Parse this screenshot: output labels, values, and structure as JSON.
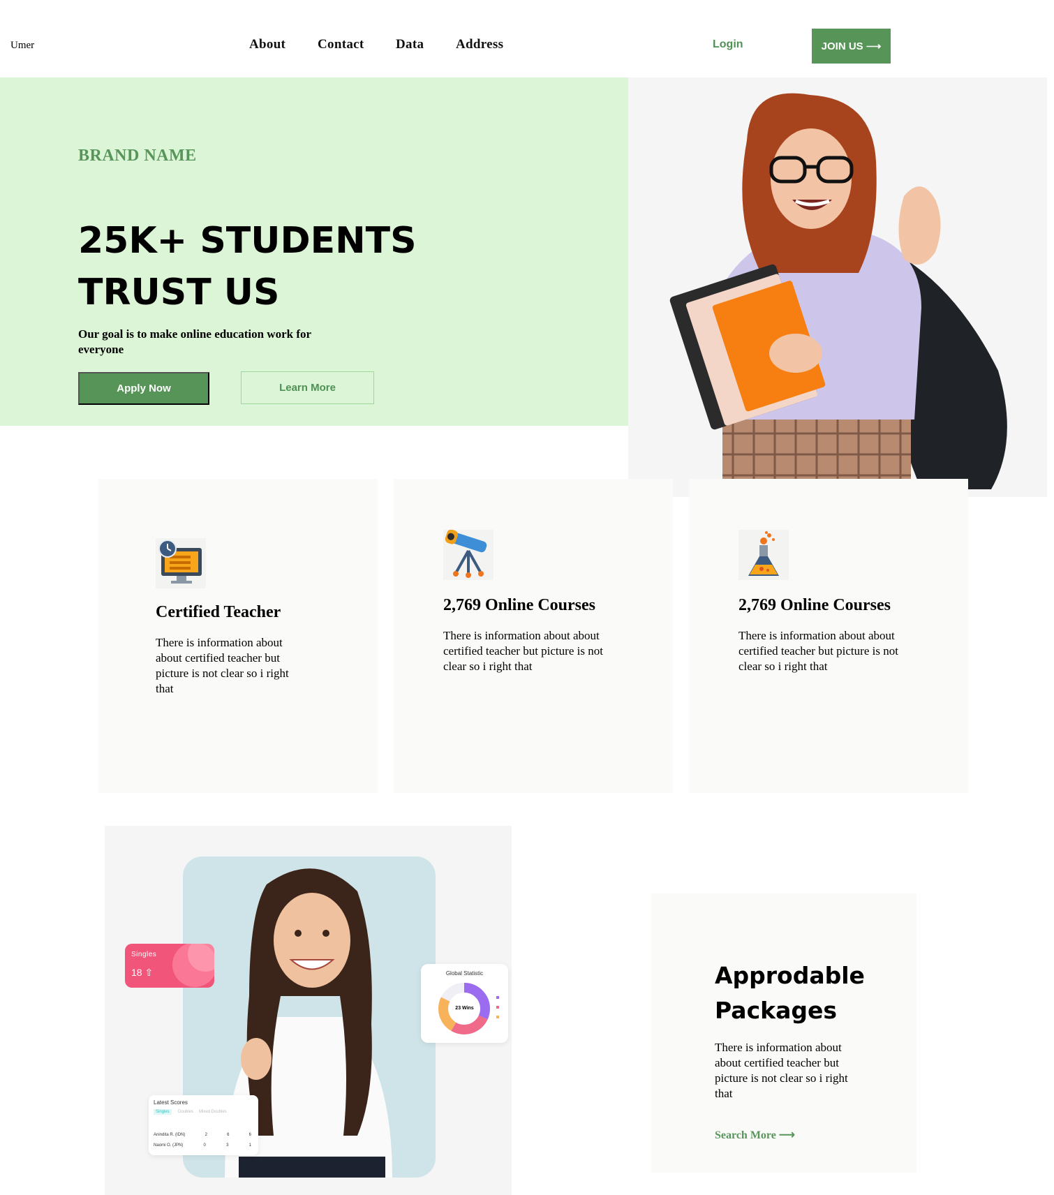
{
  "nav": {
    "logo": "Umer",
    "links": [
      "About",
      "Contact",
      "Data",
      "Address"
    ],
    "login": "Login",
    "join": "JOIN US ⟶"
  },
  "hero": {
    "brand": "BRAND NAME",
    "headline_line1": "25K+ STUDENTS",
    "headline_line2": "TRUST US",
    "tagline": "Our goal is to make online education work for everyone",
    "apply_label": "Apply Now",
    "learn_label": "Learn More"
  },
  "features": [
    {
      "icon": "monitor-clock-icon",
      "title": "Certified Teacher",
      "desc": "There is information about about certified teacher but picture is not clear so i right that"
    },
    {
      "icon": "telescope-icon",
      "title": "2,769 Online Courses",
      "desc": "There is information about about certified teacher but picture is not clear so i right that"
    },
    {
      "icon": "flask-icon",
      "title": "2,769 Online Courses",
      "desc": "There is information about about certified teacher but picture is not clear so i right that"
    }
  ],
  "widgets": {
    "singles_label": "Singles",
    "singles_value": "18 ⇧",
    "stat_title": "Global Statistic",
    "stat_center": "23 Wins",
    "scores_title": "Latest Scores",
    "scores_tabs": [
      "Singles",
      "Doubles",
      "Mixed Doubles"
    ],
    "scores_rows": [
      {
        "name": "Anindita R. (IDN)",
        "s1": "2",
        "s2": "6",
        "s3": "6"
      },
      {
        "name": "Naomi O. (JPN)",
        "s1": "0",
        "s2": "3",
        "s3": "1"
      }
    ]
  },
  "package": {
    "title_line1": "Approdable",
    "title_line2": "Packages",
    "desc": "There is information about about certified teacher but picture is not clear so i right that",
    "link": "Search More ⟶"
  },
  "colors": {
    "accent": "#569457",
    "hero_bg": "#dbf5d6",
    "card_bg": "#fafbf8"
  }
}
